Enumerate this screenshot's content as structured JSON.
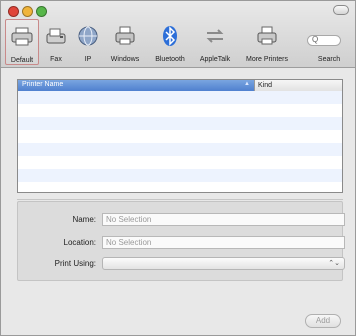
{
  "toolbar": {
    "items": [
      {
        "label": "Default",
        "icon": "printer-icon"
      },
      {
        "label": "Fax",
        "icon": "fax-icon"
      },
      {
        "label": "IP",
        "icon": "globe-icon"
      },
      {
        "label": "Windows",
        "icon": "windows-printer-icon"
      },
      {
        "label": "Bluetooth",
        "icon": "bluetooth-icon"
      },
      {
        "label": "AppleTalk",
        "icon": "appletalk-icon"
      },
      {
        "label": "More Printers",
        "icon": "more-printers-icon"
      }
    ],
    "search": {
      "label": "Search",
      "placeholder": "Q"
    }
  },
  "list": {
    "columns": {
      "name": "Printer Name",
      "kind": "Kind",
      "sort_arrow": "▲"
    }
  },
  "form": {
    "name_label": "Name:",
    "name_value": "No Selection",
    "location_label": "Location:",
    "location_value": "No Selection",
    "print_using_label": "Print Using:",
    "print_using_arrow": "⌃⌄"
  },
  "add_button": "Add",
  "colors": {
    "header_blue": "#5a8ad6",
    "row_stripe": "#edf3fe",
    "close": "#e0453a",
    "minimize": "#f0b43a",
    "zoom": "#58b74a",
    "bluetooth": "#2d6fd8"
  }
}
